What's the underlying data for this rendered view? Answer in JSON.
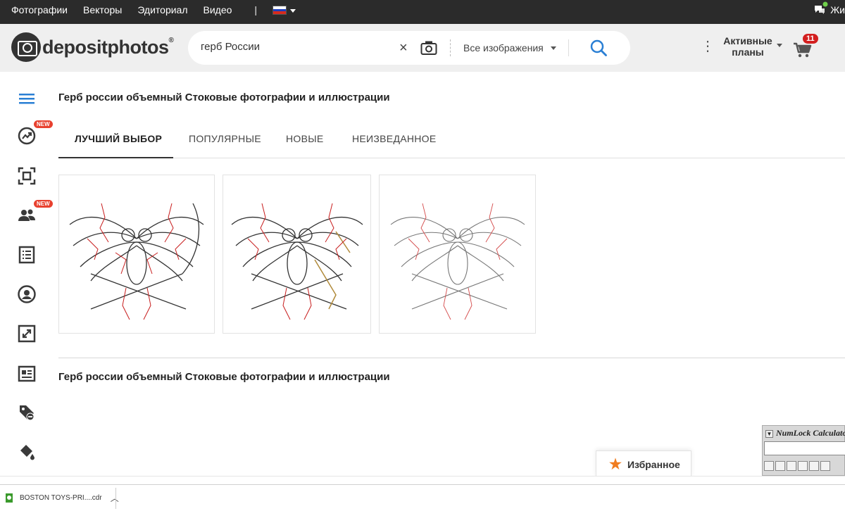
{
  "topbar": {
    "nav": [
      "Фотографии",
      "Векторы",
      "Эдиториал",
      "Видео"
    ],
    "separator": "|",
    "user_label": "Жи"
  },
  "header": {
    "logo_text": "depositphotos",
    "logo_mark": "®",
    "search_value": "герб России",
    "clear_symbol": "×",
    "category": "Все изображения",
    "plans_label": "Активные планы",
    "cart_count": "11"
  },
  "sidebar": {
    "new_badge": "NEW",
    "icons": [
      "menu-icon",
      "trending-icon",
      "visual-search-icon",
      "people-icon",
      "list-icon",
      "account-icon",
      "expand-icon",
      "article-icon",
      "tag-discount-icon",
      "paint-bucket-icon"
    ]
  },
  "main": {
    "title": "Герб россии объемный Стоковые фотографии и иллюстрации",
    "tabs": [
      "ЛУЧШИЙ ВЫБОР",
      "ПОПУЛЯРНЫЕ",
      "НОВЫЕ",
      "НЕИЗВЕДАННОЕ"
    ],
    "active_tab": 0,
    "section_title": "Герб россии объемный Стоковые фотографии и иллюстрации"
  },
  "favorites": {
    "label": "Избранное"
  },
  "numlock": {
    "title": "NumLock Calculator"
  },
  "downloads": {
    "file_name": "BOSTON TOYS-PRI....cdr"
  },
  "colors": {
    "accent": "#2a7fd4",
    "badge": "#e8412f",
    "star": "#f07c1f",
    "topbar": "#2b2b2b"
  }
}
